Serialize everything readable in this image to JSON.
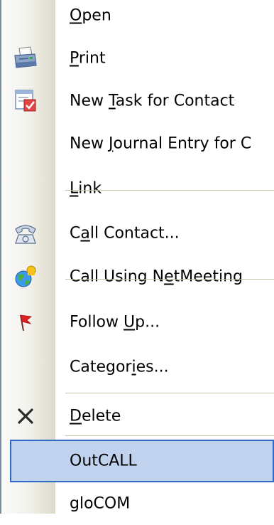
{
  "menu": {
    "items": [
      {
        "id": "open",
        "pre": "",
        "u": "O",
        "post": "pen",
        "icon": ""
      },
      {
        "id": "print",
        "pre": "",
        "u": "P",
        "post": "rint",
        "icon": "printer-icon"
      },
      {
        "id": "new-task",
        "pre": "New ",
        "u": "T",
        "post": "ask for Contact",
        "icon": "task-icon"
      },
      {
        "id": "new-journal",
        "pre": "New ",
        "u": "J",
        "post": "ournal Entry for C",
        "icon": ""
      },
      {
        "id": "link",
        "pre": "",
        "u": "L",
        "post": "ink",
        "icon": ""
      },
      {
        "id": "call-contact",
        "pre": "C",
        "u": "a",
        "post": "ll Contact...",
        "icon": "phone-icon"
      },
      {
        "id": "netmeeting",
        "pre": "Call Using N",
        "u": "e",
        "post": "tMeeting",
        "icon": "netmeeting-icon"
      },
      {
        "id": "follow-up",
        "pre": "Follow ",
        "u": "U",
        "post": "p...",
        "icon": "flag-icon"
      },
      {
        "id": "categories",
        "pre": "Categor",
        "u": "i",
        "post": "es...",
        "icon": ""
      },
      {
        "id": "delete",
        "pre": "",
        "u": "D",
        "post": "elete",
        "icon": "delete-x-icon"
      },
      {
        "id": "outcall",
        "pre": "OutCALL",
        "u": "",
        "post": "",
        "icon": "",
        "highlighted": true
      },
      {
        "id": "glocom",
        "pre": "gloCOM",
        "u": "",
        "post": "",
        "icon": ""
      }
    ]
  },
  "colors": {
    "highlight_fill": "#c1d2ee",
    "highlight_border": "#316ac5",
    "separator": "#c5c2b2",
    "frame_border": "#7d8aa6"
  }
}
